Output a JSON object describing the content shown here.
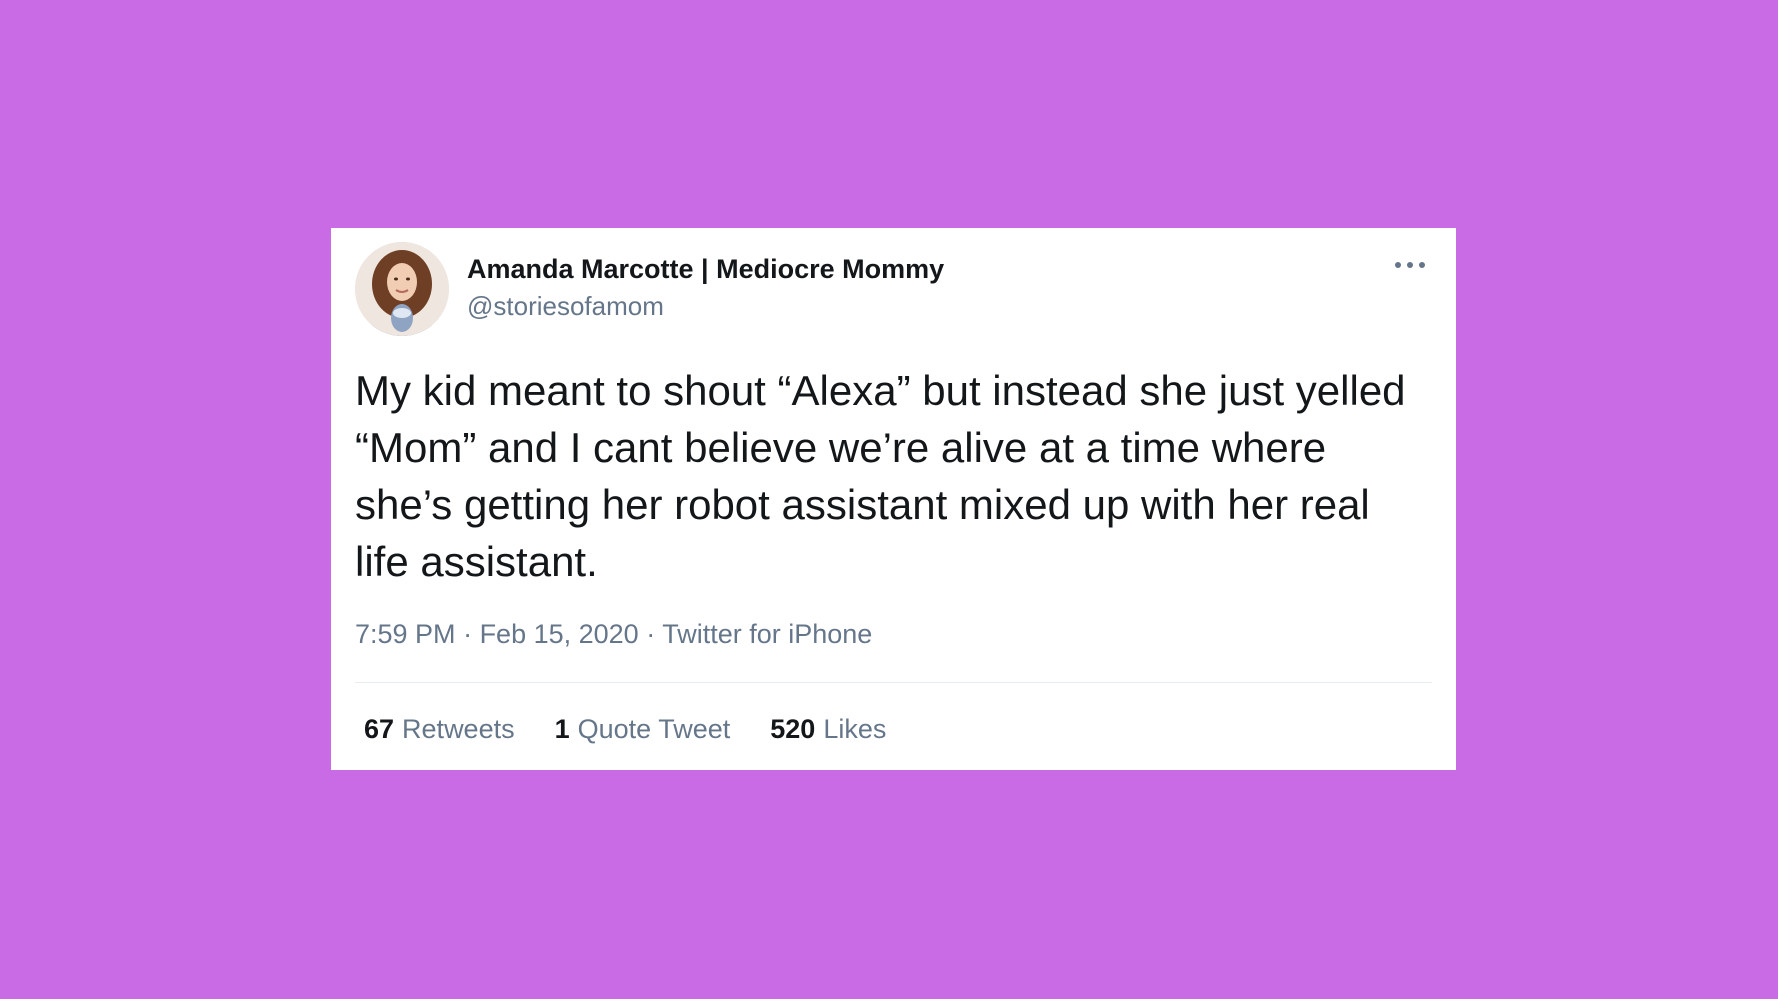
{
  "tweet": {
    "display_name": "Amanda Marcotte | Mediocre Mommy",
    "handle": "@storiesofamom",
    "text": "My kid meant to shout “Alexa” but instead she just yelled “Mom” and I cant believe we’re alive at a time where she’s getting her robot assistant mixed up with her real life assistant.",
    "time": "7:59 PM",
    "date": "Feb 15, 2020",
    "separator": " · ",
    "source": "Twitter for iPhone",
    "stats": [
      {
        "count": "67",
        "label": "Retweets"
      },
      {
        "count": "1",
        "label": "Quote Tweet"
      },
      {
        "count": "520",
        "label": "Likes"
      }
    ]
  },
  "icons": {
    "more": "more-options-icon",
    "avatar": "profile-avatar"
  },
  "colors": {
    "background": "#c86be4",
    "card": "#ffffff",
    "primary_text": "#14171a",
    "secondary_text": "#66768a",
    "divider": "#e6ecf0"
  }
}
